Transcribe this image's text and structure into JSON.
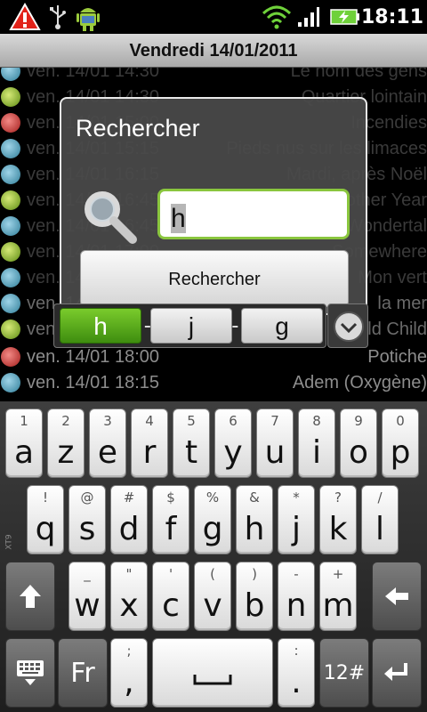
{
  "status_bar": {
    "time": "18:11",
    "icons": [
      "warning-icon",
      "usb-icon",
      "android-debug-icon",
      "wifi-icon",
      "signal-icon",
      "battery-charging-icon"
    ]
  },
  "header": {
    "title": "Vendredi 14/01/2011"
  },
  "list": {
    "rows": [
      {
        "date": "ven. 14/01 14:30",
        "title": "Le nom des gens",
        "icon": "blue"
      },
      {
        "date": "ven. 14/01 14:30",
        "title": "Quartier lointain",
        "icon": "green"
      },
      {
        "date": "ven. 14/01 15:00",
        "title": "Incendies",
        "icon": "red"
      },
      {
        "date": "ven. 14/01 15:15",
        "title": "Pieds nus sur les limaces",
        "icon": "blue"
      },
      {
        "date": "ven. 14/01 16:15",
        "title": "Mardi, après Noël",
        "icon": "blue"
      },
      {
        "date": "ven. 14/01 16:45",
        "title": "Another Year",
        "icon": "green"
      },
      {
        "date": "ven. 14/01 16:45",
        "title": "Wondertal",
        "icon": "blue"
      },
      {
        "date": "ven. 14/01 17:00",
        "title": "Somewhere",
        "icon": "green"
      },
      {
        "date": "ven. 14/01 17:15",
        "title": "Mon vert",
        "icon": "blue"
      },
      {
        "date": "ven. 14/01 17:30",
        "title": "la mer",
        "icon": "blue"
      },
      {
        "date": "ven. 14/01 17:45",
        "title": "Wild Child",
        "icon": "green"
      },
      {
        "date": "ven. 14/01 18:00",
        "title": "Potiche",
        "icon": "red"
      },
      {
        "date": "ven. 14/01 18:15",
        "title": "Adem (Oxygène)",
        "icon": "blue"
      }
    ]
  },
  "dialog": {
    "title": "Rechercher",
    "input_value": "h",
    "button_label": "Rechercher"
  },
  "suggestions": {
    "items": [
      "h",
      "j",
      "g"
    ]
  },
  "keyboard": {
    "side_label": "XT9",
    "row1": [
      {
        "num": "1",
        "letter": "a"
      },
      {
        "num": "2",
        "letter": "z"
      },
      {
        "num": "3",
        "letter": "e"
      },
      {
        "num": "4",
        "letter": "r"
      },
      {
        "num": "5",
        "letter": "t"
      },
      {
        "num": "6",
        "letter": "y"
      },
      {
        "num": "7",
        "letter": "u"
      },
      {
        "num": "8",
        "letter": "i"
      },
      {
        "num": "9",
        "letter": "o"
      },
      {
        "num": "0",
        "letter": "p"
      }
    ],
    "row2": [
      {
        "sym": "!",
        "letter": "q"
      },
      {
        "sym": "@",
        "letter": "s"
      },
      {
        "sym": "#",
        "letter": "d"
      },
      {
        "sym": "$",
        "letter": "f"
      },
      {
        "sym": "%",
        "letter": "g"
      },
      {
        "sym": "&",
        "letter": "h"
      },
      {
        "sym": "*",
        "letter": "j"
      },
      {
        "sym": "?",
        "letter": "k"
      },
      {
        "sym": "/",
        "letter": "l"
      }
    ],
    "row3": [
      {
        "sym": "_",
        "letter": "w"
      },
      {
        "sym": "\"",
        "letter": "x"
      },
      {
        "sym": "'",
        "letter": "c"
      },
      {
        "sym": "(",
        "letter": "v"
      },
      {
        "sym": ")",
        "letter": "b"
      },
      {
        "sym": "-",
        "letter": "n"
      },
      {
        "sym": "+",
        "letter": "m"
      }
    ],
    "row4": {
      "lang": "Fr",
      "punct_top": ";",
      "punct_main": ",",
      "space_label": "⎵",
      "dot_top": ":",
      "dot_main": ".",
      "numeric": "12#"
    }
  }
}
